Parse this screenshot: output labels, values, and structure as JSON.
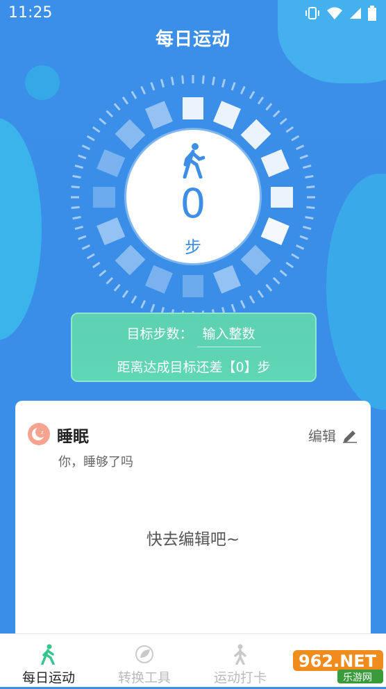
{
  "status": {
    "time": "11:25"
  },
  "header": {
    "title": "每日运动"
  },
  "dial": {
    "steps": "0",
    "unit": "步",
    "progress": 0
  },
  "goal": {
    "label": "目标步数：",
    "placeholder": "输入整数",
    "remaining": "距离达成目标还差【0】步"
  },
  "sleep_card": {
    "title": "睡眠",
    "edit_label": "编辑",
    "subtitle": "你，睡够了吗",
    "empty_text": "快去编辑吧~"
  },
  "tabs": [
    {
      "label": "每日运动",
      "active": true
    },
    {
      "label": "转换工具",
      "active": false
    },
    {
      "label": "运动打卡",
      "active": false
    }
  ],
  "watermark": {
    "text": "962.NET",
    "sub": "乐游网"
  },
  "colors": {
    "accent": "#3d8ee6",
    "goal_bg": "#5fd6b6",
    "moon": "#f6a38f"
  }
}
